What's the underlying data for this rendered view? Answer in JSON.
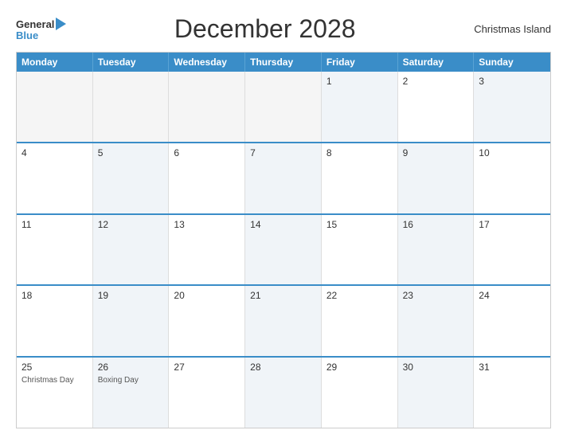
{
  "header": {
    "title": "December 2028",
    "location": "Christmas Island",
    "logo_general": "General",
    "logo_blue": "Blue"
  },
  "calendar": {
    "days_of_week": [
      "Monday",
      "Tuesday",
      "Wednesday",
      "Thursday",
      "Friday",
      "Saturday",
      "Sunday"
    ],
    "weeks": [
      [
        {
          "day": "",
          "empty": true
        },
        {
          "day": "",
          "empty": true
        },
        {
          "day": "",
          "empty": true
        },
        {
          "day": "",
          "empty": true
        },
        {
          "day": "1",
          "shaded": true
        },
        {
          "day": "2"
        },
        {
          "day": "3",
          "shaded": true
        }
      ],
      [
        {
          "day": "4"
        },
        {
          "day": "5",
          "shaded": true
        },
        {
          "day": "6"
        },
        {
          "day": "7",
          "shaded": true
        },
        {
          "day": "8"
        },
        {
          "day": "9",
          "shaded": true
        },
        {
          "day": "10"
        }
      ],
      [
        {
          "day": "11"
        },
        {
          "day": "12",
          "shaded": true
        },
        {
          "day": "13"
        },
        {
          "day": "14",
          "shaded": true
        },
        {
          "day": "15"
        },
        {
          "day": "16",
          "shaded": true
        },
        {
          "day": "17"
        }
      ],
      [
        {
          "day": "18"
        },
        {
          "day": "19",
          "shaded": true
        },
        {
          "day": "20"
        },
        {
          "day": "21",
          "shaded": true
        },
        {
          "day": "22"
        },
        {
          "day": "23",
          "shaded": true
        },
        {
          "day": "24"
        }
      ],
      [
        {
          "day": "25",
          "event": "Christmas Day"
        },
        {
          "day": "26",
          "shaded": true,
          "event": "Boxing Day"
        },
        {
          "day": "27"
        },
        {
          "day": "28",
          "shaded": true
        },
        {
          "day": "29"
        },
        {
          "day": "30",
          "shaded": true
        },
        {
          "day": "31"
        }
      ]
    ]
  }
}
